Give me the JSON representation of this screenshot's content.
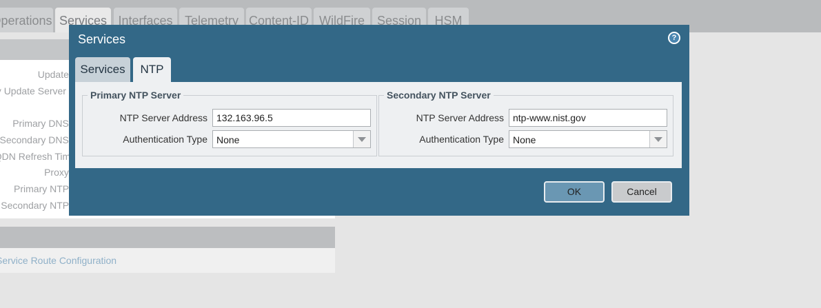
{
  "background": {
    "tabs": [
      {
        "label": "Operations"
      },
      {
        "label": "Services"
      },
      {
        "label": "Interfaces"
      },
      {
        "label": "Telemetry"
      },
      {
        "label": "Content-ID"
      },
      {
        "label": "WildFire"
      },
      {
        "label": "Session"
      },
      {
        "label": "HSM"
      }
    ],
    "labels": [
      "Update Server",
      "Verify Update Server Identity",
      "Primary DNS Server",
      "Secondary DNS Server",
      "FQDN Refresh Time (sec)",
      "Proxy Server",
      "Primary NTP Server",
      "Secondary NTP Server"
    ],
    "section_link": "Service Route Configuration"
  },
  "dialog": {
    "title": "Services",
    "tabs": [
      {
        "label": "Services"
      },
      {
        "label": "NTP"
      }
    ],
    "primary": {
      "legend": "Primary NTP Server",
      "address_label": "NTP Server Address",
      "address_value": "132.163.96.5",
      "auth_label": "Authentication Type",
      "auth_value": "None"
    },
    "secondary": {
      "legend": "Secondary NTP Server",
      "address_label": "NTP Server Address",
      "address_value": "ntp-www.nist.gov",
      "auth_label": "Authentication Type",
      "auth_value": "None"
    },
    "ok_label": "OK",
    "cancel_label": "Cancel"
  }
}
